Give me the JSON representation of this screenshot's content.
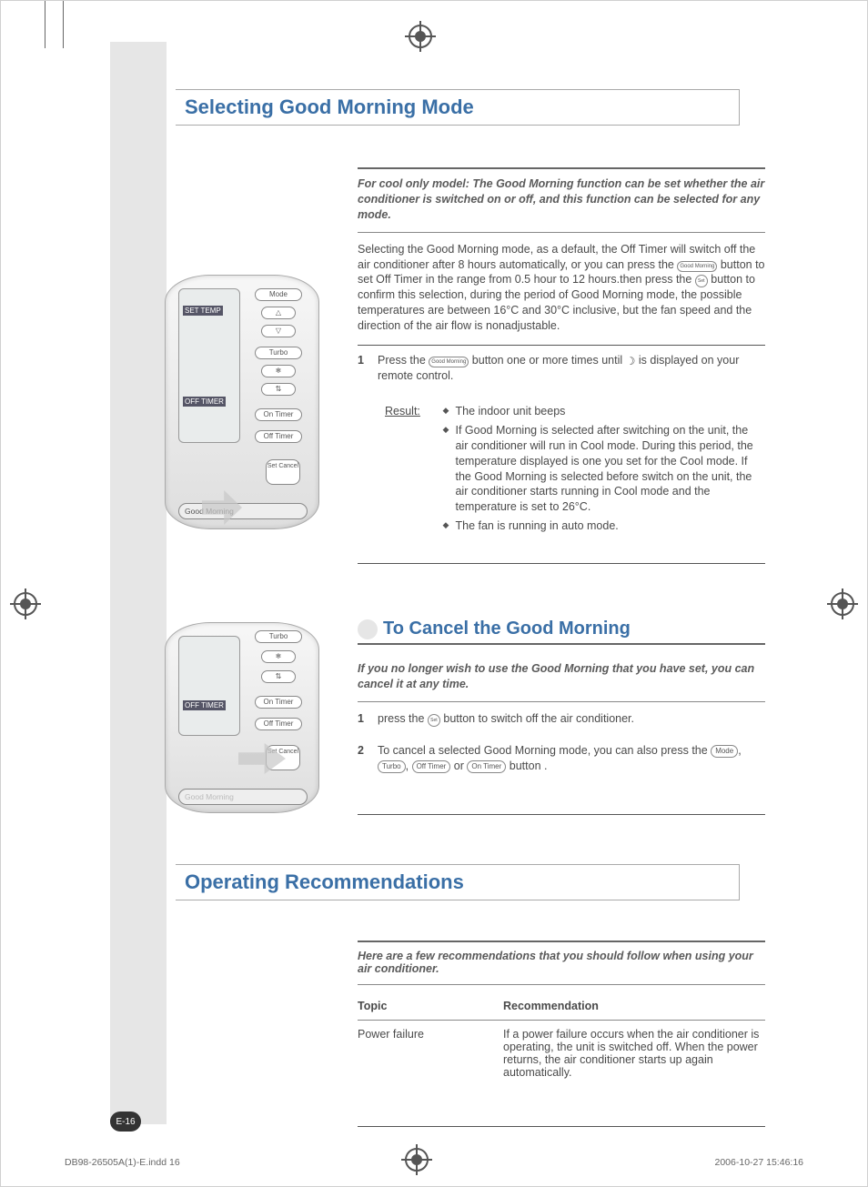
{
  "section1_title": "Selecting Good Morning Mode",
  "intro_note": "For cool only model: The Good Morning function can be set whether the air conditioner is switched on or off, and this function can be selected for any mode.",
  "intro_paragraph_a": "Selecting the Good Morning mode, as a default, the Off Timer will switch off the air conditioner after 8 hours automatically, or you can press the ",
  "intro_icon1_label": "Good Morning",
  "intro_paragraph_b": " button to set Off Timer in the range from 0.5 hour to 12 hours.then press the ",
  "intro_icon2_label": "Set",
  "intro_paragraph_c": " button to confirm this selection, during the period of Good Morning mode, the possible temperatures are between 16°C and 30°C inclusive, but the fan speed and the direction of the air flow is nonadjustable.",
  "step1_n": "1",
  "step1_a": "Press the ",
  "step1_icon": "Good Morning",
  "step1_b": " button one or more times until ",
  "step1_moon": "☽",
  "step1_c": " is displayed on your remote control.",
  "result_label": "Result:",
  "result_bullets": [
    "The indoor unit beeps",
    "If Good Morning is selected after switching on the unit, the air conditioner will run in Cool mode. During this period, the temperature displayed is one you set for the Cool mode. If the Good Morning is selected before switch on the unit, the air conditioner starts running in Cool mode and the temperature is set to 26°C.",
    "The fan is running in auto mode."
  ],
  "sub_header": "To Cancel the Good Morning",
  "cancel_intro": "If you no longer wish to use the Good Morning that you have set, you can cancel it at any time.",
  "cancel_step1_n": "1",
  "cancel_step1_a": "press the ",
  "cancel_step1_icon": "Set",
  "cancel_step1_b": " button to switch off the air conditioner.",
  "cancel_step2_n": "2",
  "cancel_step2_a": "To cancel a selected Good Morning mode, you can also press the ",
  "cancel_step2_icons": [
    "Mode",
    "Turbo",
    "Off Timer",
    "On Timer"
  ],
  "cancel_step2_sep": ", ",
  "cancel_step2_or": " or ",
  "cancel_step2_b": " button .",
  "section2_title": "Operating Recommendations",
  "rec_intro": "Here are a few recommendations that you should follow when using your air conditioner.",
  "rec_headers": {
    "topic": "Topic",
    "rec": "Recommendation"
  },
  "rec_rows": [
    {
      "topic": "Power failure",
      "rec": "If a power failure occurs when the air conditioner is operating, the unit is switched off. When the power returns, the air conditioner starts up again automatically."
    }
  ],
  "remote1": {
    "set_temp_lbl": "SET TEMP",
    "off_timer_lbl": "OFF TIMER",
    "btns": [
      "Mode",
      "△",
      "▽",
      "Turbo",
      "❄",
      "⇅",
      "On Timer",
      "Off Timer",
      "Set Cancel"
    ],
    "bar": "Good Morning",
    "arrow": true
  },
  "remote2": {
    "off_timer_lbl": "OFF TIMER",
    "btns": [
      "Turbo",
      "❄",
      "⇅",
      "On Timer",
      "Off Timer",
      "Set Cancel"
    ],
    "bar": "Good Morning",
    "arrow_on_set": true
  },
  "page_badge": "E-16",
  "foot_left": "DB98-26505A(1)-E.indd   16",
  "foot_right": "2006-10-27   15:46:16"
}
